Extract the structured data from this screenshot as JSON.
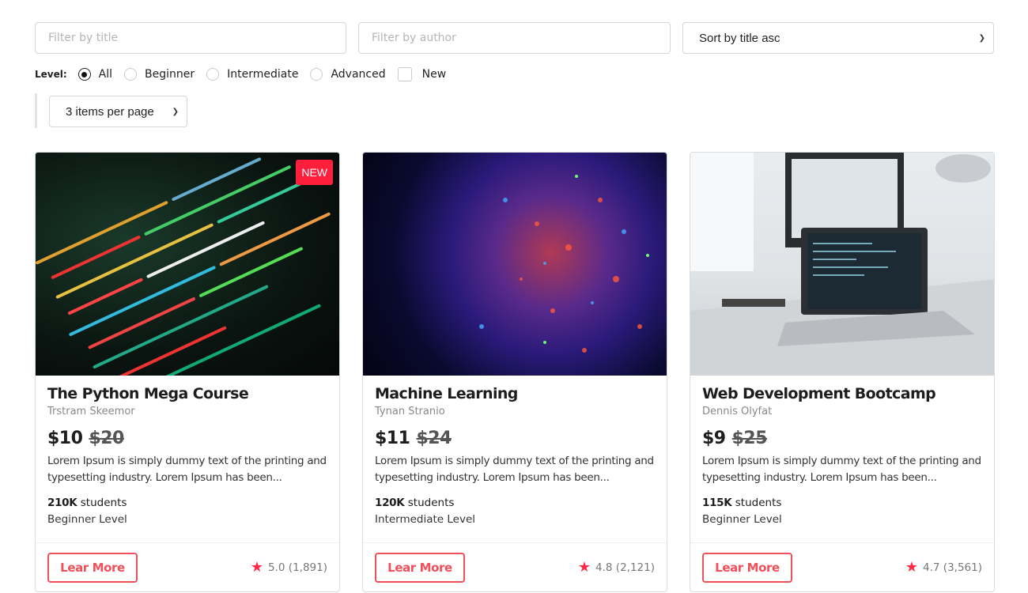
{
  "filters": {
    "title_placeholder": "Filter by title",
    "author_placeholder": "Filter by author",
    "sort_value": "Sort by title asc",
    "level_label": "Level:",
    "levels": [
      "All",
      "Beginner",
      "Intermediate",
      "Advanced"
    ],
    "selected_level": "All",
    "new_label": "New",
    "per_page": "3 items per page"
  },
  "accent": "#f0505a",
  "cards": [
    {
      "title": "The Python Mega Course",
      "author": "Trstram Skeemor",
      "price": "$10",
      "old_price": "$20",
      "desc": "Lorem Ipsum is simply dummy text of the printing and typesetting industry. Lorem Ipsum has been...",
      "students_count": "210K",
      "students_label": "students",
      "level": "Beginner Level",
      "button": "Lear More",
      "rating": "5.0 (1,891)",
      "badge": "NEW"
    },
    {
      "title": "Machine Learning",
      "author": "Tynan Stranio",
      "price": "$11",
      "old_price": "$24",
      "desc": "Lorem Ipsum is simply dummy text of the printing and typesetting industry. Lorem Ipsum has been...",
      "students_count": "120K",
      "students_label": "students",
      "level": "Intermediate Level",
      "button": "Lear More",
      "rating": "4.8 (2,121)"
    },
    {
      "title": "Web Development Bootcamp",
      "author": "Dennis Olyfat",
      "price": "$9",
      "old_price": "$25",
      "desc": "Lorem Ipsum is simply dummy text of the printing and typesetting industry. Lorem Ipsum has been...",
      "students_count": "115K",
      "students_label": "students",
      "level": "Beginner Level",
      "button": "Lear More",
      "rating": "4.7 (3,561)"
    }
  ]
}
